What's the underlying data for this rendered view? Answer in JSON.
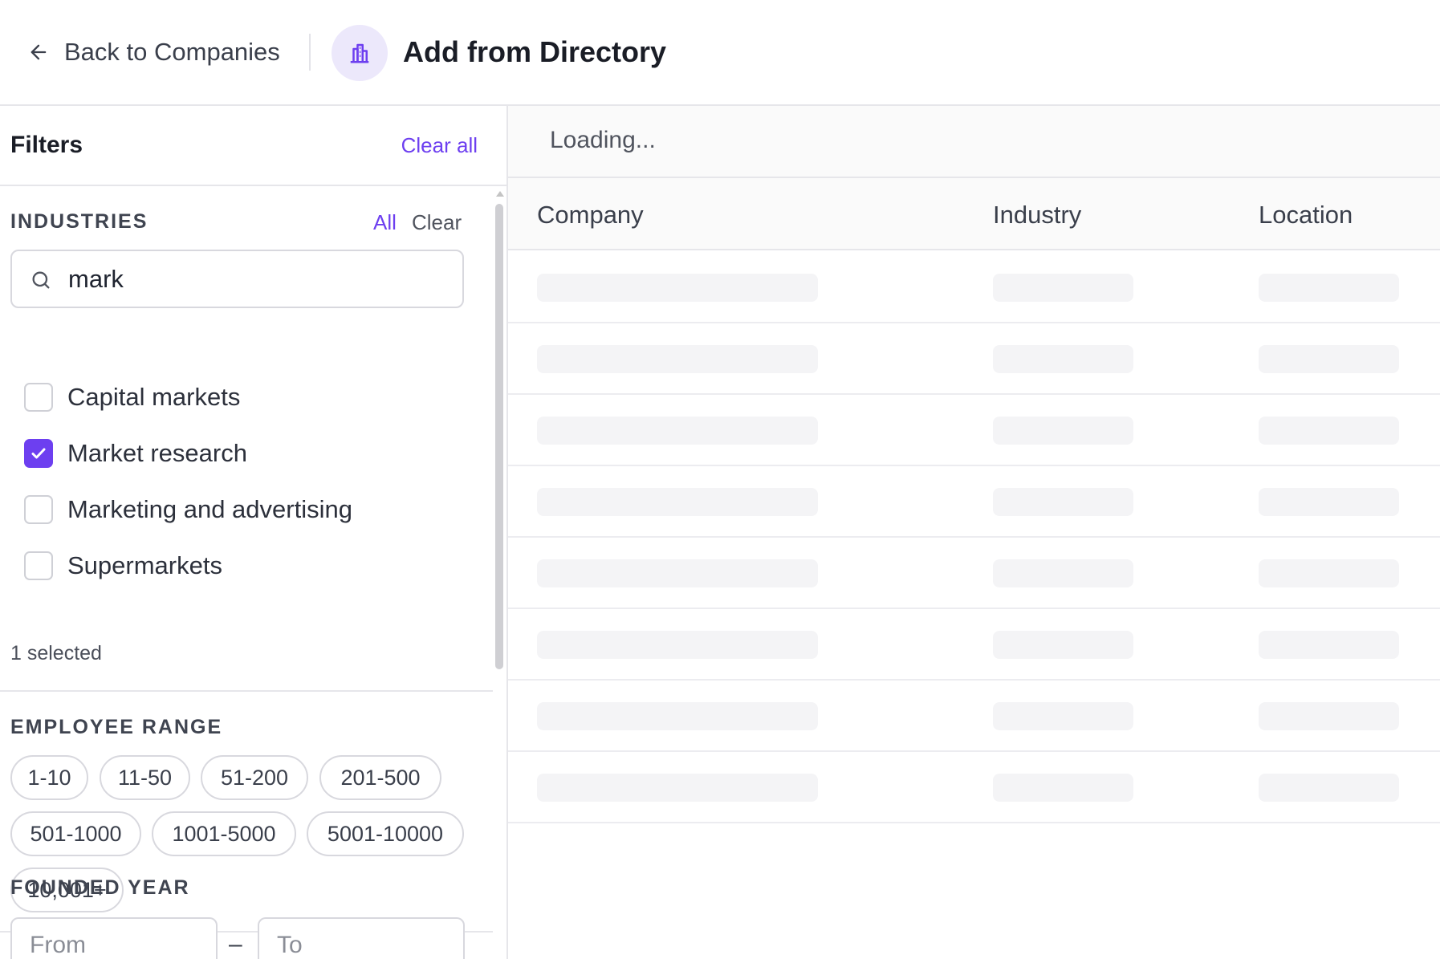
{
  "header": {
    "back_label": "Back to Companies",
    "title": "Add from Directory",
    "back_icon": "arrow-left-icon",
    "avatar_icon": "building-icon",
    "accent_color": "#6d3ff0"
  },
  "filters": {
    "title": "Filters",
    "clear_all_label": "Clear all",
    "industries": {
      "label": "INDUSTRIES",
      "all_label": "All",
      "clear_label": "Clear",
      "search_value": "mark",
      "options": [
        {
          "label": "Capital markets",
          "checked": false
        },
        {
          "label": "Market research",
          "checked": true
        },
        {
          "label": "Marketing and advertising",
          "checked": false
        },
        {
          "label": "Supermarkets",
          "checked": false
        }
      ],
      "selected_text": "1 selected"
    },
    "employee_range": {
      "label": "EMPLOYEE RANGE",
      "options": [
        "1-10",
        "11-50",
        "51-200",
        "201-500",
        "501-1000",
        "1001-5000",
        "5001-10000",
        "10,001+"
      ]
    },
    "founded_year": {
      "label": "FOUNDED YEAR",
      "from_placeholder": "From",
      "to_placeholder": "To",
      "separator": "–"
    }
  },
  "main": {
    "loading_text": "Loading...",
    "columns": [
      "Company",
      "Industry",
      "Location"
    ],
    "skeleton_row_count": 8
  }
}
